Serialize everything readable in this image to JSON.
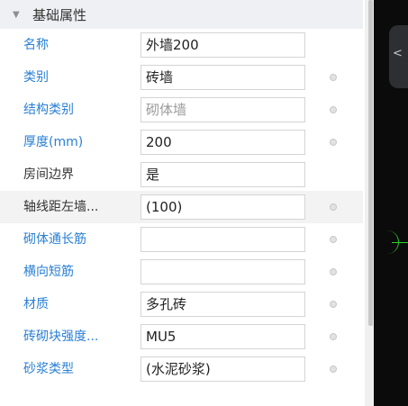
{
  "section": {
    "title": "基础属性",
    "toggle_icon": "triangle-down-icon"
  },
  "properties": [
    {
      "label": "名称",
      "value": "外墙200",
      "label_color": "link",
      "alt": false,
      "dot": false,
      "disabled": false
    },
    {
      "label": "类别",
      "value": "砖墙",
      "label_color": "link",
      "alt": false,
      "dot": true,
      "disabled": false
    },
    {
      "label": "结构类别",
      "value": "砌体墙",
      "label_color": "link",
      "alt": false,
      "dot": true,
      "disabled": true
    },
    {
      "label": "厚度(mm)",
      "value": "200",
      "label_color": "link",
      "alt": false,
      "dot": true,
      "disabled": false
    },
    {
      "label": "房间边界",
      "value": "是",
      "label_color": "plain",
      "alt": false,
      "dot": false,
      "disabled": false
    },
    {
      "label": "轴线距左墙...",
      "value": "(100)",
      "label_color": "plain",
      "alt": true,
      "dot": true,
      "disabled": false
    },
    {
      "label": "砌体通长筋",
      "value": "",
      "label_color": "link",
      "alt": false,
      "dot": true,
      "disabled": false
    },
    {
      "label": "横向短筋",
      "value": "",
      "label_color": "link",
      "alt": false,
      "dot": true,
      "disabled": false
    },
    {
      "label": "材质",
      "value": "多孔砖",
      "label_color": "link",
      "alt": false,
      "dot": true,
      "disabled": false
    },
    {
      "label": "砖砌块强度...",
      "value": "MU5",
      "label_color": "link",
      "alt": false,
      "dot": true,
      "disabled": false
    },
    {
      "label": "砂浆类型",
      "value": "(水泥砂浆)",
      "label_color": "link",
      "alt": false,
      "dot": true,
      "disabled": false
    }
  ],
  "canvas": {
    "collapse_icon": "chevron-left-icon",
    "collapse_glyph": "<"
  },
  "colors": {
    "link": "#2a7fd4",
    "header_bg": "#eef0f3",
    "alt_row": "#f3f3f3",
    "canvas_bg": "#0b0b0b",
    "axis_green": "#2bd12b"
  }
}
